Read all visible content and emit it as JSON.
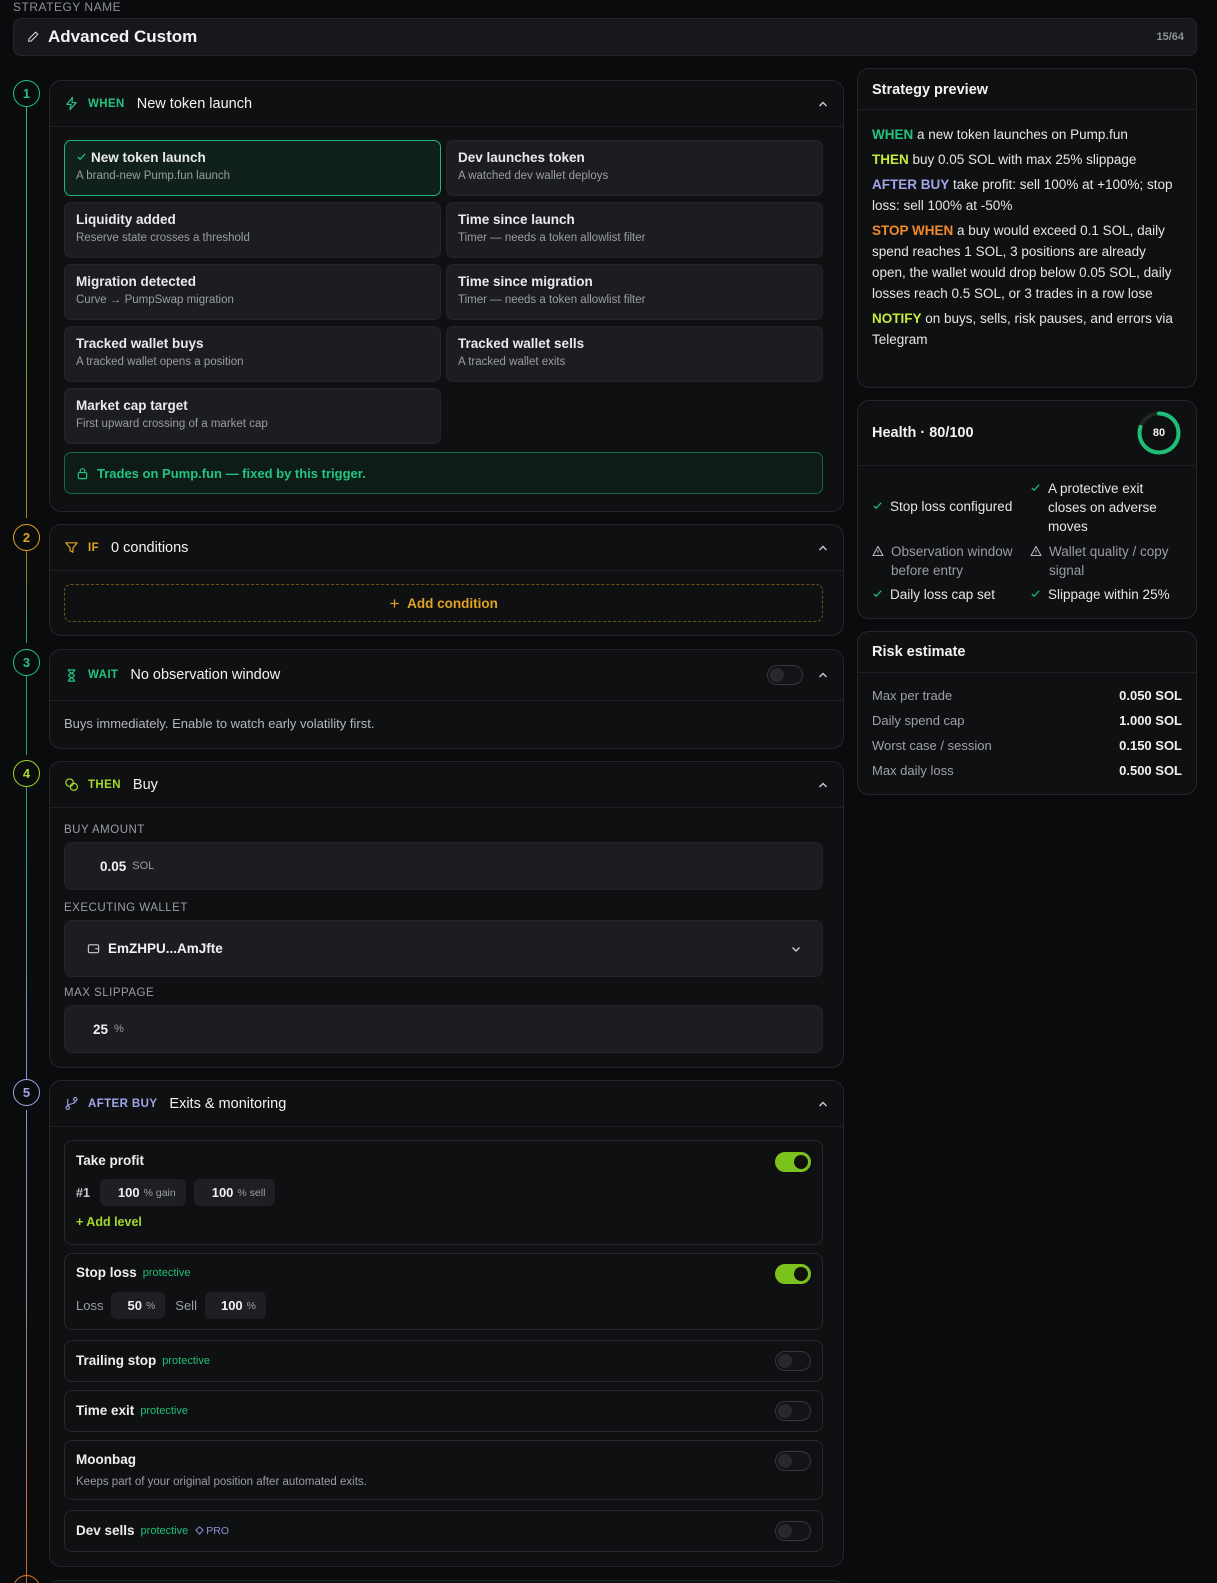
{
  "strategy": {
    "label": "STRATEGY NAME",
    "name": "Advanced Custom",
    "char_count": "15/64"
  },
  "steps": [
    {
      "num": "1",
      "keyword": "WHEN",
      "title": "New token launch",
      "color": "#22c47f"
    },
    {
      "num": "2",
      "keyword": "IF",
      "title": "0 conditions",
      "color": "#e0a321"
    },
    {
      "num": "3",
      "keyword": "WAIT",
      "title": "No observation window",
      "color": "#22c47f"
    },
    {
      "num": "4",
      "keyword": "THEN",
      "title": "Buy",
      "color": "#a3d92b"
    },
    {
      "num": "5",
      "keyword": "AFTER BUY",
      "title": "Exits & monitoring",
      "color": "#9fa6e8"
    }
  ],
  "trigger_options": [
    {
      "title": "New token launch",
      "desc": "A brand-new Pump.fun launch",
      "selected": true
    },
    {
      "title": "Dev launches token",
      "desc": "A watched dev wallet deploys"
    },
    {
      "title": "Liquidity added",
      "desc": "Reserve state crosses a threshold"
    },
    {
      "title": "Time since launch",
      "desc": "Timer — needs a token allowlist filter"
    },
    {
      "title": "Migration detected",
      "desc": "Curve → PumpSwap migration"
    },
    {
      "title": "Time since migration",
      "desc": "Timer — needs a token allowlist filter"
    },
    {
      "title": "Tracked wallet buys",
      "desc": "A tracked wallet opens a position"
    },
    {
      "title": "Tracked wallet sells",
      "desc": "A tracked wallet exits"
    },
    {
      "title": "Market cap target",
      "desc": "First upward crossing of a market cap"
    }
  ],
  "trigger_lock_note": "Trades on Pump.fun — fixed by this trigger.",
  "add_condition_label": "Add condition",
  "wait_note": "Buys immediately. Enable to watch early volatility first.",
  "wait_enabled": false,
  "buy": {
    "amount_label": "BUY AMOUNT",
    "amount": "0.05",
    "amount_unit": "SOL",
    "wallet_label": "EXECUTING WALLET",
    "wallet": "EmZHPU...AmJfte",
    "slippage_label": "MAX SLIPPAGE",
    "slippage": "25",
    "slippage_unit": "%"
  },
  "exits": {
    "take_profit": {
      "title": "Take profit",
      "enabled": true,
      "level_num": "#1",
      "gain": "100",
      "gain_unit": "% gain",
      "sell": "100",
      "sell_unit": "% sell",
      "add_level": "+ Add level"
    },
    "stop_loss": {
      "title": "Stop loss",
      "tag": "protective",
      "enabled": true,
      "loss_label": "Loss",
      "loss": "50",
      "loss_unit": "%",
      "sell_label": "Sell",
      "sell": "100",
      "sell_unit": "%"
    },
    "trailing_stop": {
      "title": "Trailing stop",
      "tag": "protective",
      "enabled": false
    },
    "time_exit": {
      "title": "Time exit",
      "tag": "protective",
      "enabled": false
    },
    "moonbag": {
      "title": "Moonbag",
      "desc": "Keeps part of your original position after automated exits.",
      "enabled": false
    },
    "dev_sells": {
      "title": "Dev sells",
      "tag": "protective",
      "pro": "PRO",
      "enabled": false
    }
  },
  "preview": {
    "title": "Strategy preview",
    "lines": [
      {
        "kw": "WHEN",
        "text": " a new token launches on Pump.fun",
        "color": "#22c47f"
      },
      {
        "kw": "THEN",
        "text": " buy 0.05 SOL with max 25% slippage",
        "color": "#c4ec3a"
      },
      {
        "kw": "AFTER BUY",
        "text": " take profit: sell 100% at +100%; stop loss: sell 100% at -50%",
        "color": "#9fa6e8"
      },
      {
        "kw": "STOP WHEN",
        "text": " a buy would exceed 0.1 SOL, daily spend reaches 1 SOL, 3 positions are already open, the wallet would drop below 0.05 SOL, daily losses reach 0.5 SOL, or 3 trades in a row lose",
        "color": "#f08a2c"
      },
      {
        "kw": "NOTIFY",
        "text": " on buys, sells, risk pauses, and errors via Telegram",
        "color": "#c4ec3a"
      }
    ]
  },
  "health": {
    "title": "Health · 80/100",
    "score": "80",
    "score_fraction": 0.8,
    "checks": [
      {
        "text": "Stop loss configured",
        "status": "ok"
      },
      {
        "text": "A protective exit closes on adverse moves",
        "status": "ok"
      },
      {
        "text": "Observation window before entry",
        "status": "warn"
      },
      {
        "text": "Wallet quality / copy signal",
        "status": "warn"
      },
      {
        "text": "Daily loss cap set",
        "status": "ok"
      },
      {
        "text": "Slippage within 25%",
        "status": "ok"
      }
    ]
  },
  "risk": {
    "title": "Risk estimate",
    "rows": [
      {
        "label": "Max per trade",
        "value": "0.050 SOL"
      },
      {
        "label": "Daily spend cap",
        "value": "1.000 SOL"
      },
      {
        "label": "Worst case / session",
        "value": "0.150 SOL"
      },
      {
        "label": "Max daily loss",
        "value": "0.500 SOL"
      }
    ]
  }
}
